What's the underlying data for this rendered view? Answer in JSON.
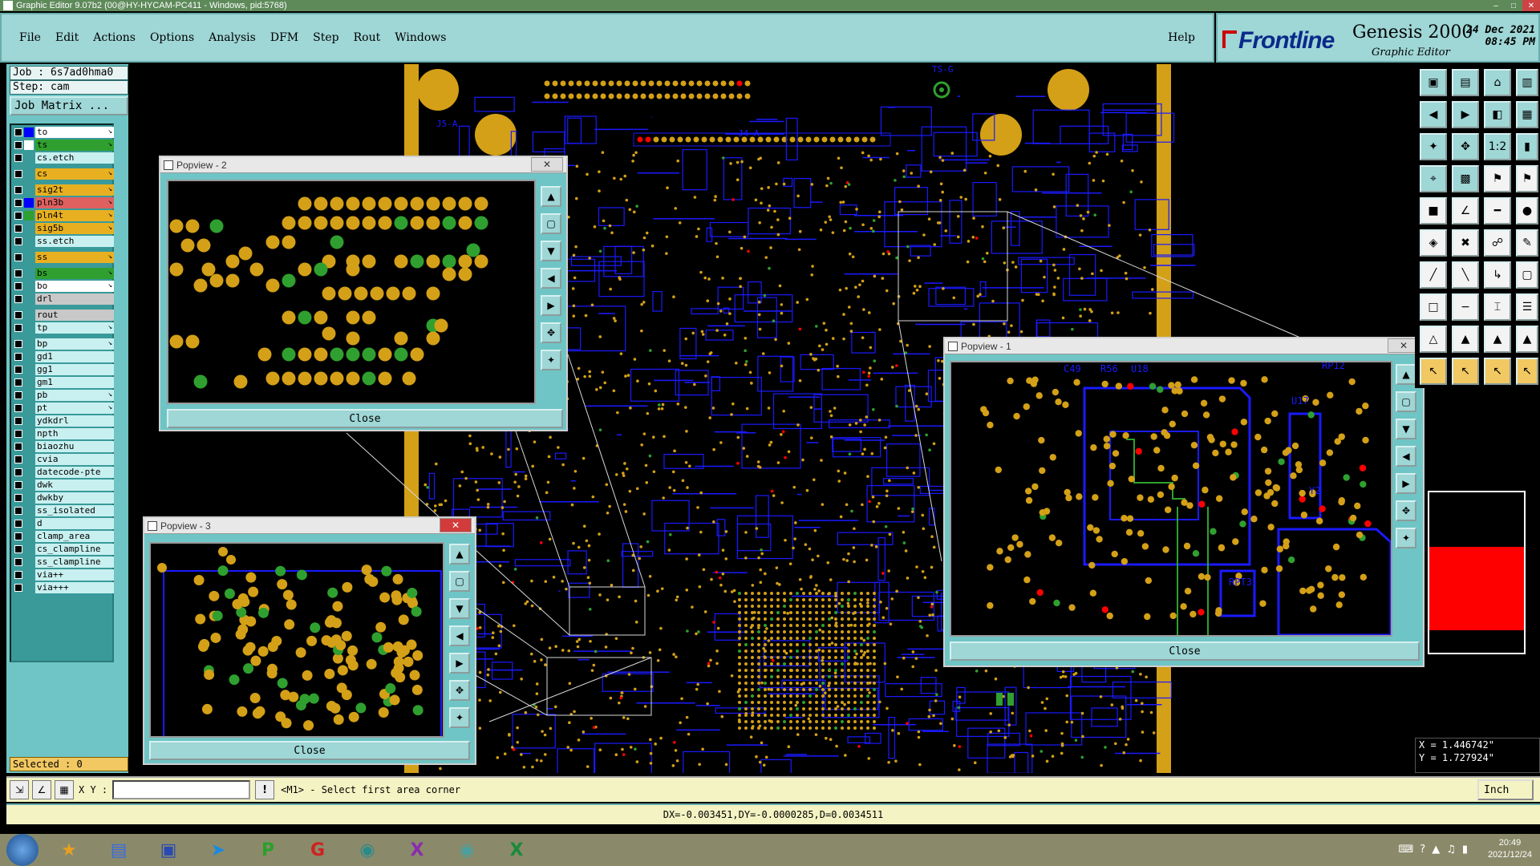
{
  "window": {
    "title": "Graphic Editor 9.07b2 (00@HY-HYCAM-PC411 - Windows, pid:5768)"
  },
  "menu": [
    "File",
    "Edit",
    "Actions",
    "Options",
    "Analysis",
    "DFM",
    "Step",
    "Rout",
    "Windows"
  ],
  "help_label": "Help",
  "brand": {
    "logo": "Frontline",
    "product": "Genesis 2000",
    "subtitle": "Graphic Editor",
    "date": "24 Dec 2021",
    "time": "08:45 PM"
  },
  "job": {
    "job_label": "Job : 6s7ad0hma0",
    "step_label": "Step: cam",
    "matrix_button": "Job Matrix ..."
  },
  "layers": [
    {
      "name": "to",
      "color": "#ffffff",
      "swatch": "#0000ff",
      "arrow": true
    },
    {
      "name": "ts",
      "color": "#2fa02f",
      "swatch": "#ffffff",
      "arrow": true
    },
    {
      "name": "cs.etch",
      "color": "#c8f0f0",
      "swatch": "",
      "arrow": false
    },
    {
      "name": "cs",
      "color": "#e8b020",
      "swatch": "",
      "arrow": true
    },
    {
      "name": "sig2t",
      "color": "#e8b020",
      "swatch": "",
      "arrow": true
    },
    {
      "name": "pln3b",
      "color": "#e06060",
      "swatch": "#0000ff",
      "arrow": true
    },
    {
      "name": "pln4t",
      "color": "#e8b020",
      "swatch": "#2fa02f",
      "arrow": true
    },
    {
      "name": "sig5b",
      "color": "#e8b020",
      "swatch": "",
      "arrow": true
    },
    {
      "name": "ss.etch",
      "color": "#c8f0f0",
      "swatch": "",
      "arrow": false
    },
    {
      "name": "ss",
      "color": "#e8b020",
      "swatch": "",
      "arrow": true
    },
    {
      "name": "bs",
      "color": "#2fa02f",
      "swatch": "",
      "arrow": true
    },
    {
      "name": "bo",
      "color": "#ffffff",
      "swatch": "",
      "arrow": true
    },
    {
      "name": "drl",
      "color": "#c8c8c8",
      "swatch": "",
      "arrow": false
    },
    {
      "name": "rout",
      "color": "#c8c8c8",
      "swatch": "",
      "arrow": false
    },
    {
      "name": "tp",
      "color": "#c8f0f0",
      "swatch": "",
      "arrow": true
    },
    {
      "name": "bp",
      "color": "#c8f0f0",
      "swatch": "",
      "arrow": true
    },
    {
      "name": "gd1",
      "color": "#c8f0f0",
      "swatch": "",
      "arrow": false
    },
    {
      "name": "gg1",
      "color": "#c8f0f0",
      "swatch": "",
      "arrow": false
    },
    {
      "name": "gm1",
      "color": "#c8f0f0",
      "swatch": "",
      "arrow": false
    },
    {
      "name": "pb",
      "color": "#c8f0f0",
      "swatch": "",
      "arrow": true
    },
    {
      "name": "pt",
      "color": "#c8f0f0",
      "swatch": "",
      "arrow": true
    },
    {
      "name": "ydkdrl",
      "color": "#c8f0f0",
      "swatch": "",
      "arrow": false
    },
    {
      "name": "npth",
      "color": "#c8f0f0",
      "swatch": "",
      "arrow": false
    },
    {
      "name": "biaozhu",
      "color": "#c8f0f0",
      "swatch": "",
      "arrow": false
    },
    {
      "name": "cvia",
      "color": "#c8f0f0",
      "swatch": "",
      "arrow": false
    },
    {
      "name": "datecode-pte",
      "color": "#c8f0f0",
      "swatch": "",
      "arrow": false
    },
    {
      "name": "dwk",
      "color": "#c8f0f0",
      "swatch": "",
      "arrow": false
    },
    {
      "name": "dwkby",
      "color": "#c8f0f0",
      "swatch": "",
      "arrow": false
    },
    {
      "name": "ss_isolated",
      "color": "#c8f0f0",
      "swatch": "",
      "arrow": false
    },
    {
      "name": "d",
      "color": "#c8f0f0",
      "swatch": "",
      "arrow": false
    },
    {
      "name": "clamp_area",
      "color": "#c8f0f0",
      "swatch": "",
      "arrow": false
    },
    {
      "name": "cs_clampline",
      "color": "#c8f0f0",
      "swatch": "",
      "arrow": false
    },
    {
      "name": "ss_clampline",
      "color": "#c8f0f0",
      "swatch": "",
      "arrow": false
    },
    {
      "name": "via++",
      "color": "#c8f0f0",
      "swatch": "",
      "arrow": false
    },
    {
      "name": "via+++",
      "color": "#c8f0f0",
      "swatch": "",
      "arrow": false
    }
  ],
  "selected_label": "Selected : 0",
  "popviews": [
    {
      "title": "Popview - 2",
      "close_label": "Close"
    },
    {
      "title": "Popview - 3",
      "close_label": "Close"
    },
    {
      "title": "Popview - 1",
      "close_label": "Close"
    }
  ],
  "board_labels": [
    "J5-A",
    "J4-A",
    "TS-G",
    "C49",
    "R56",
    "U18",
    "RP12",
    "U17",
    "Y2",
    "RPT3"
  ],
  "command": {
    "xy_label": "X Y :",
    "xy_value": "",
    "prompt": "<M1> - Select first area corner",
    "unit": "Inch"
  },
  "status": "DX=-0.003451,DY=-0.0000285,D=0.0034511",
  "cursor": {
    "x": "X = 1.446742\"",
    "y": "Y = 1.727924\""
  },
  "taskbar": {
    "time": "20:49",
    "date": "2021/12/24"
  },
  "colors": {
    "panel": "#6fc5c5",
    "menu": "#9fd6d6",
    "pad_yellow": "#d4a017",
    "pad_green": "#2fa02f",
    "pad_red": "#ff0000",
    "trace_blue": "#1a1aff"
  }
}
